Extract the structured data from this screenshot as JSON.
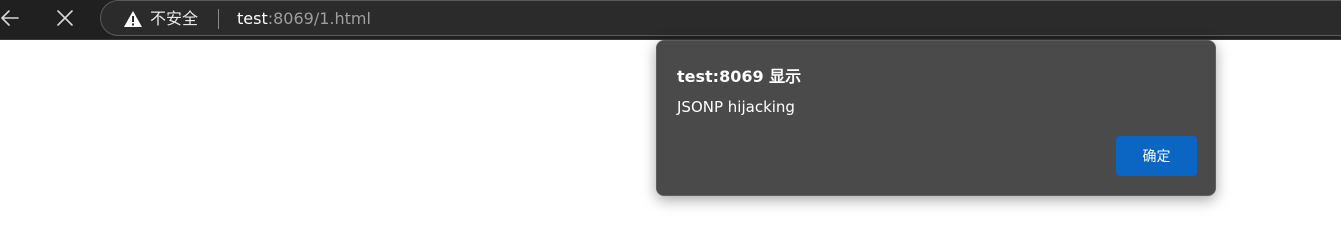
{
  "browser": {
    "back_icon": "back-arrow-icon",
    "stop_icon": "close-icon",
    "security": {
      "icon": "warning-icon",
      "label": "不安全"
    },
    "url": {
      "host": "test",
      "rest": ":8069/1.html"
    }
  },
  "dialog": {
    "title": "test:8069 显示",
    "message": "JSONP hijacking",
    "ok_label": "确定",
    "ok_color": "#0a66c2"
  }
}
